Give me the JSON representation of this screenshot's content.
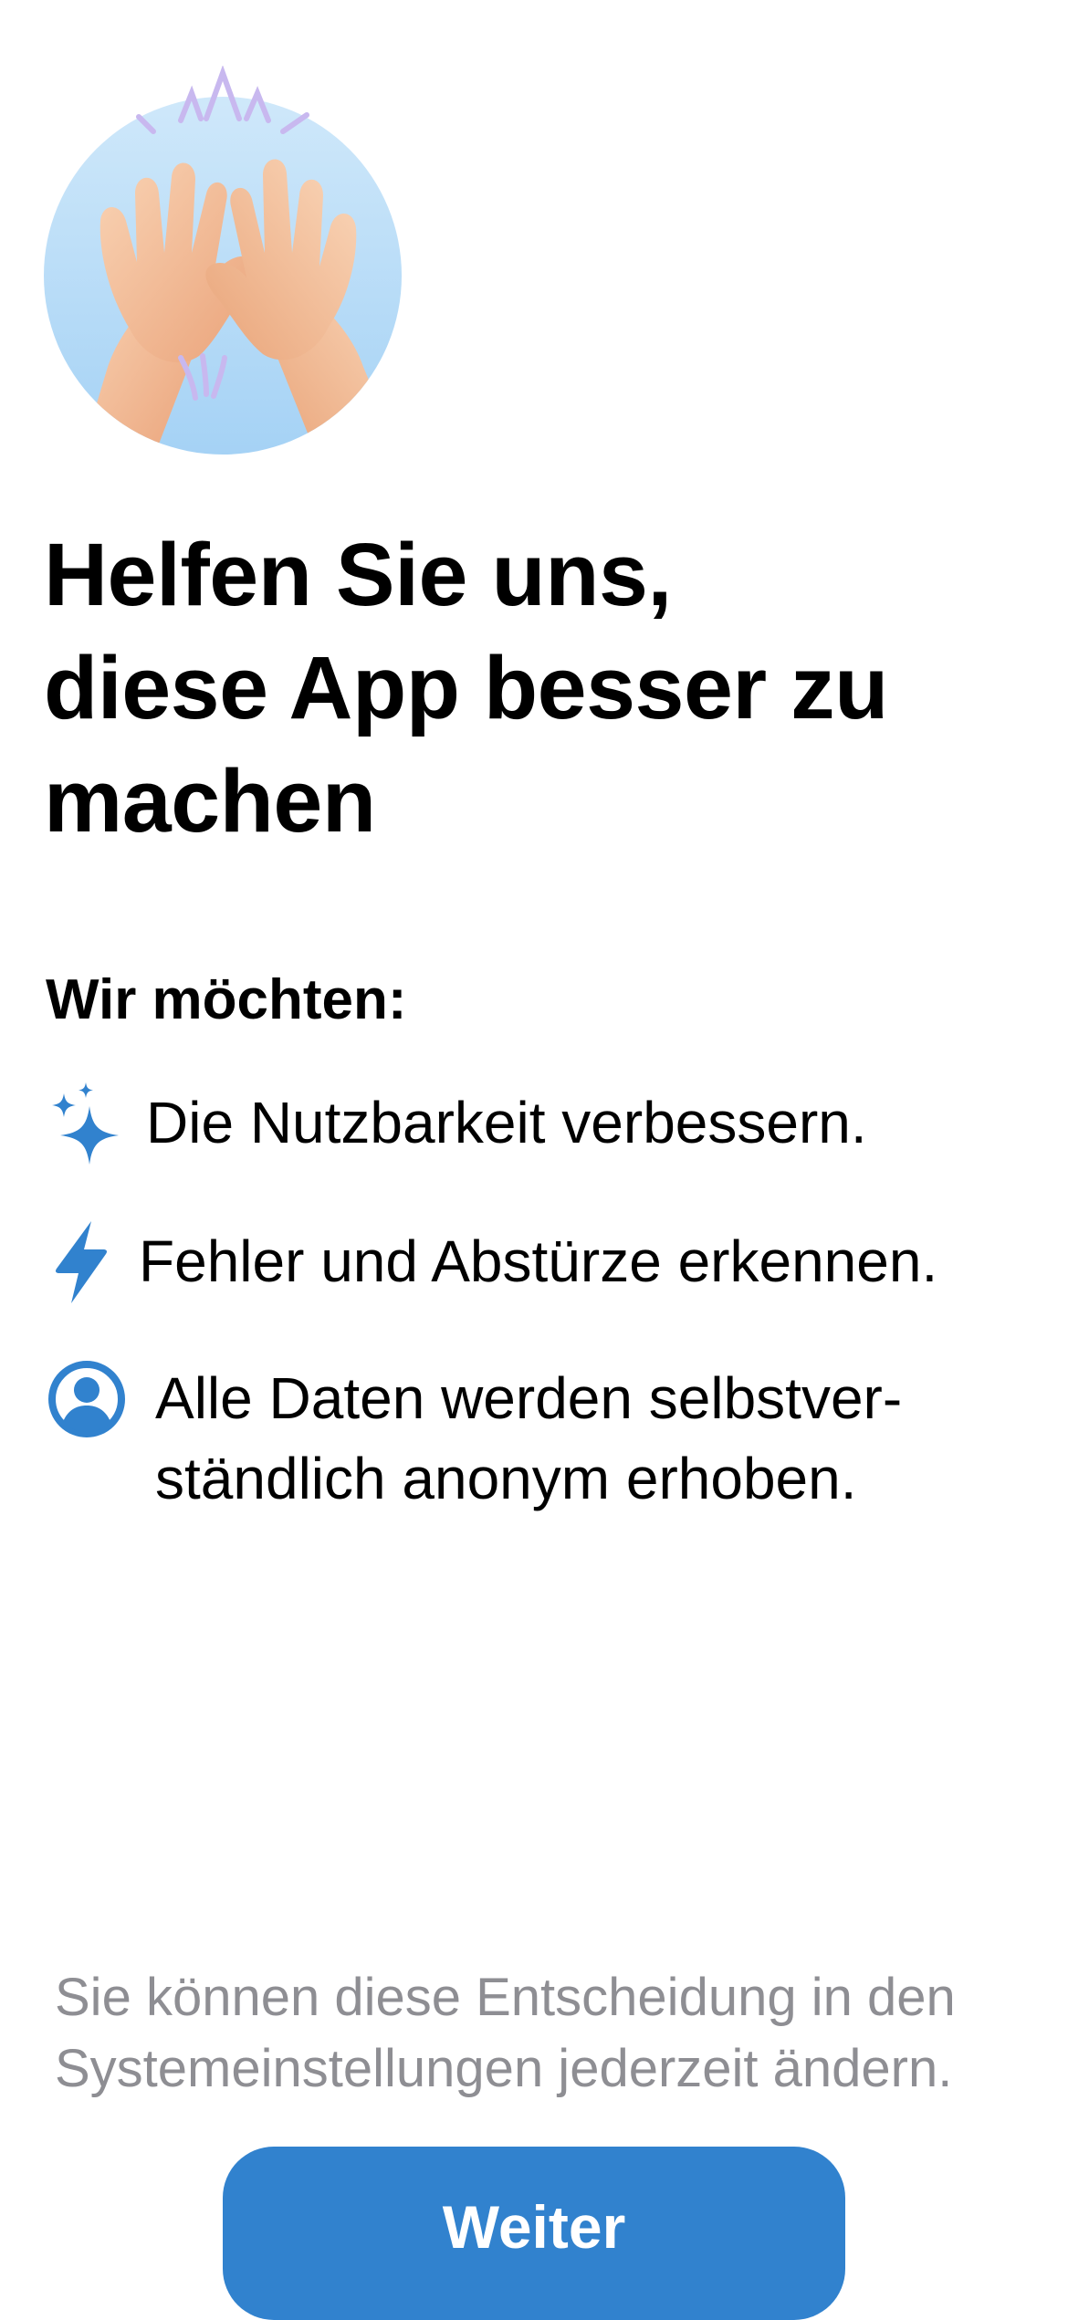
{
  "hero": {
    "icon": "high-five-hands-illustration"
  },
  "title": {
    "line1": "Helfen Sie uns,",
    "line2": "diese App besser zu",
    "line3": "machen"
  },
  "subtitle": "Wir möchten:",
  "features": [
    {
      "icon": "sparkles-icon",
      "line1": "Die Nutzbarkeit verbessern."
    },
    {
      "icon": "bolt-icon",
      "line1": "Fehler und Abstürze erkennen."
    },
    {
      "icon": "person-circle-icon",
      "line1": "Alle Daten werden selbstver-",
      "line2": "ständlich anonym erhoben."
    }
  ],
  "footnote": {
    "line1": "Sie können diese Entscheidung in den",
    "line2": "Systemeinstellungen jederzeit ändern."
  },
  "continue_label": "Weiter",
  "colors": {
    "accent": "#3182ce",
    "text": "#000000",
    "secondary_text": "#8e8e93",
    "background": "#ffffff"
  }
}
